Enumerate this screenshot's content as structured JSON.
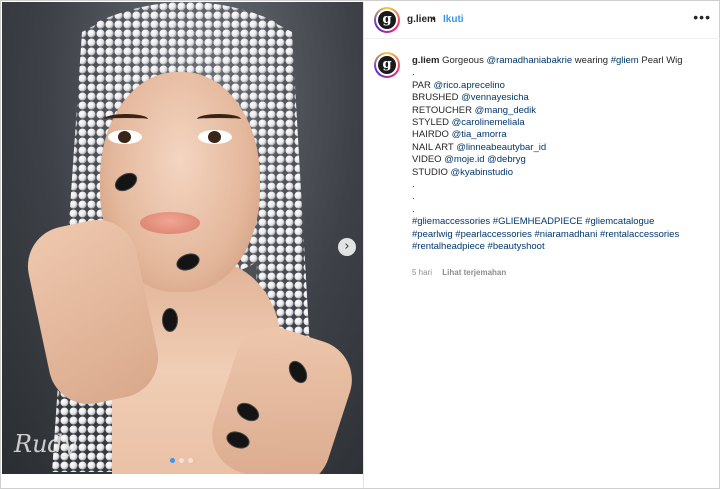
{
  "post": {
    "username": "g.liem",
    "separator": "•",
    "follow_label": "Ikuti",
    "more_icon": "more-dots-icon",
    "avatar_letter": "g",
    "image": {
      "description_icon": "photo",
      "signature": "Rudy",
      "next_icon": "chevron-right-icon",
      "next_glyph": "›",
      "carousel_dots": 3,
      "active_dot": 0
    }
  },
  "caption": {
    "username": "g.liem",
    "line1": {
      "a": "Gorgeous ",
      "m1": "@ramadhaniabakrie",
      "b": " wearing ",
      "m2": "#gliem",
      "c": " Pearl Wig"
    },
    "dot1": ".",
    "credits": [
      {
        "label": "PAR ",
        "mention": "@rico.aprecelino"
      },
      {
        "label": "BRUSHED ",
        "mention": "@vennayesicha"
      },
      {
        "label": "RETOUCHER ",
        "mention": "@mang_dedik"
      },
      {
        "label": "STYLED ",
        "mention": "@carolinemeliala"
      },
      {
        "label": "HAIRDO ",
        "mention": "@tia_amorra"
      },
      {
        "label": "NAIL ART ",
        "mention": "@linneabeautybar_id"
      },
      {
        "label": "VIDEO ",
        "mention": "@moje.id @debryg"
      },
      {
        "label": "STUDIO ",
        "mention": "@kyabinstudio"
      }
    ],
    "dots": [
      ".",
      ".",
      "."
    ],
    "hashtags": [
      "#gliemaccessories #GLIEMHEADPIECE #gliemcatalogue",
      "#pearlwig #pearlaccessories #niaramadhani #rentalaccessories",
      "#rentalheadpiece #beautyshoot"
    ]
  },
  "meta": {
    "time": "5 hari",
    "translate": "Lihat terjemahan"
  },
  "colors": {
    "link": "#00376b",
    "follow": "#3897f0",
    "text": "#262626",
    "muted": "#8e8e8e"
  }
}
